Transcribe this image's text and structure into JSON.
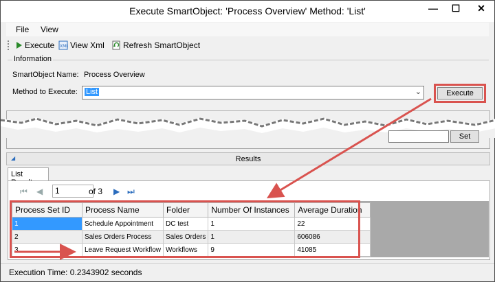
{
  "window": {
    "title": "Execute SmartObject: 'Process Overview' Method: 'List'",
    "minimize": "—",
    "maximize": "☐",
    "close": "✕"
  },
  "menu": {
    "file": "File",
    "view": "View"
  },
  "toolbar": {
    "execute": "Execute",
    "view_xml": "View Xml",
    "refresh": "Refresh SmartObject"
  },
  "information": {
    "legend": "Information",
    "smartobject_label": "SmartObject Name:",
    "smartobject_value": "Process Overview",
    "method_label": "Method to Execute:",
    "method_value": "List",
    "execute_button": "Execute"
  },
  "parameters": {
    "set_button": "Set"
  },
  "results": {
    "title": "Results",
    "tab": "List Results",
    "pager": {
      "page": "1",
      "of_text": "of 3"
    },
    "columns": [
      "Process Set ID",
      "Process Name",
      "Folder",
      "Number Of Instances",
      "Average Duration"
    ],
    "rows": [
      [
        "1",
        "Schedule Appointment",
        "DC test",
        "1",
        "22"
      ],
      [
        "2",
        "Sales Orders Process",
        "Sales Orders",
        "1",
        "606086"
      ],
      [
        "3",
        "Leave Request Workflow",
        "Workflows",
        "9",
        "41085"
      ]
    ]
  },
  "status": {
    "execution_time": "Execution Time: 0.2343902 seconds"
  },
  "colors": {
    "annotation_red": "#d9534f",
    "selection_blue": "#3399ff",
    "link_blue": "#2a6cbd"
  }
}
